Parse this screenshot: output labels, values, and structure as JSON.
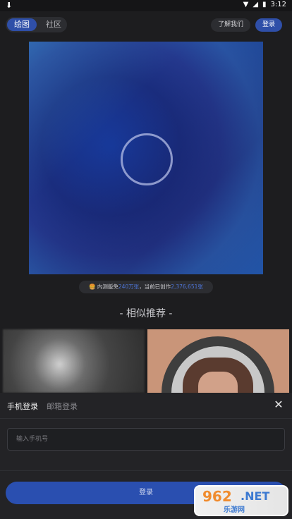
{
  "status_bar": {
    "time": "3:12",
    "icons": [
      "download-icon",
      "wifi-icon",
      "signal-icon",
      "battery-icon"
    ]
  },
  "header": {
    "tabs": [
      {
        "label": "绘图",
        "active": true
      },
      {
        "label": "社区",
        "active": false
      }
    ],
    "about_label": "了解我们",
    "login_label": "登录"
  },
  "preview": {
    "loading": true
  },
  "stats": {
    "prefix": "内测版免",
    "free_count": "240万张",
    "middle": "，当前已创作",
    "created_count": "2,376,651张"
  },
  "recommendations": {
    "title": "- 相似推荐 -"
  },
  "login_sheet": {
    "tabs": [
      {
        "label": "手机登录",
        "active": true
      },
      {
        "label": "邮箱登录",
        "active": false
      }
    ],
    "phone_placeholder": "输入手机号",
    "submit_label": "登录"
  },
  "watermark": {
    "top": "962",
    "net": ".NET",
    "bottom": "乐游网"
  },
  "colors": {
    "accent": "#2f4fa8",
    "background": "#1d1d1f",
    "highlight_number": "#4d74d6"
  }
}
